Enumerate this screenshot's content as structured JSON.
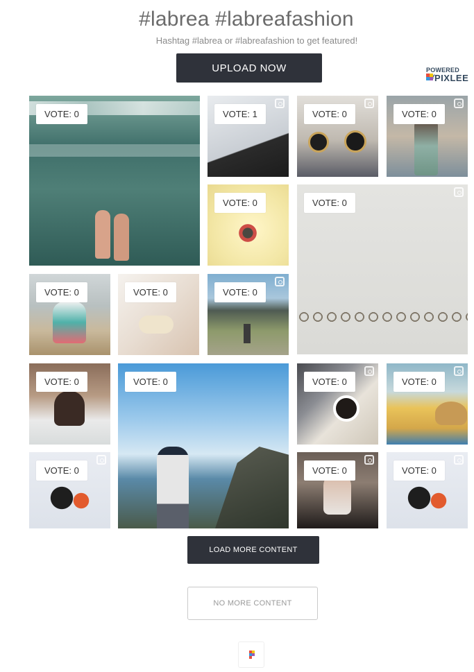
{
  "header": {
    "title": "#labrea #labreafashion",
    "subtitle": "Hashtag #labrea or #labreafashion to get featured!",
    "upload_label": "UPLOAD NOW"
  },
  "powered_by": {
    "line1": "POWERED BY",
    "brand": "PIXLEE"
  },
  "gallery": {
    "tiles": [
      {
        "vote": "VOTE: 0",
        "instagram": false
      },
      {
        "vote": "VOTE: 1",
        "instagram": true
      },
      {
        "vote": "VOTE: 0",
        "instagram": true
      },
      {
        "vote": "VOTE: 0",
        "instagram": true
      },
      {
        "vote": "VOTE: 0",
        "instagram": false
      },
      {
        "vote": "VOTE: 0",
        "instagram": true
      },
      {
        "vote": "VOTE: 0",
        "instagram": false
      },
      {
        "vote": "VOTE: 0",
        "instagram": false
      },
      {
        "vote": "VOTE: 0",
        "instagram": true
      },
      {
        "vote": "VOTE: 0",
        "instagram": false
      },
      {
        "vote": "VOTE: 0",
        "instagram": false
      },
      {
        "vote": "VOTE: 0",
        "instagram": true
      },
      {
        "vote": "VOTE: 0",
        "instagram": false
      },
      {
        "vote": "VOTE: 0",
        "instagram": true
      },
      {
        "vote": "VOTE: 0",
        "instagram": true
      },
      {
        "vote": "VOTE: 0",
        "instagram": true
      }
    ]
  },
  "actions": {
    "load_more": "LOAD MORE CONTENT",
    "no_more": "NO MORE CONTENT"
  },
  "colors": {
    "button_dark": "#2f323a",
    "brand_text": "#34495e"
  }
}
